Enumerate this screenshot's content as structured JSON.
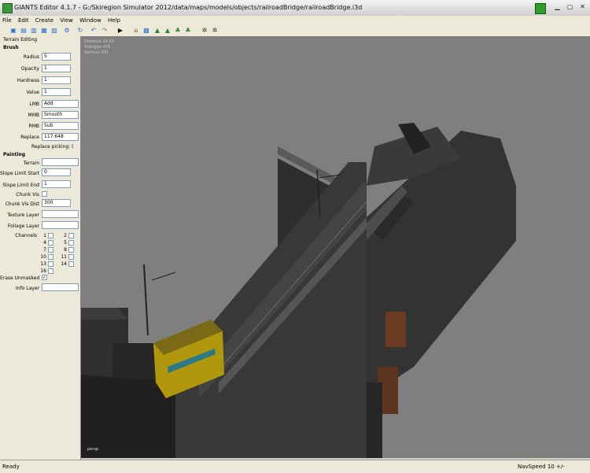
{
  "window": {
    "title": "GIANTS Editor 4.1.7 - G:/Skiregion Simulator 2012/data/maps/models/objects/railroadBridge/railroadBridge.i3d"
  },
  "menu": [
    "File",
    "Edit",
    "Create",
    "View",
    "Window",
    "Help"
  ],
  "panel": {
    "title": "Terrain Editing",
    "brush": {
      "heading": "Brush",
      "radius_label": "Radius",
      "radius_value": "5",
      "opacity_label": "Opacity",
      "opacity_value": "1",
      "hardness_label": "Hardness",
      "hardness_value": "1",
      "value_label": "Value",
      "value_value": "1",
      "lmb_label": "LMB",
      "lmb_value": "Add",
      "mmb_label": "MMB",
      "mmb_value": "Smooth",
      "rmb_label": "RMB",
      "rmb_value": "Sub",
      "replace_label": "Replace",
      "replace_value": "117.648",
      "replace_picking_label": "Replace picking: (",
      "replace_picking_value": ""
    },
    "painting": {
      "heading": "Painting",
      "terrain_label": "Terrain",
      "terrain_value": "",
      "slope_start_label": "Slope Limit Start",
      "slope_start_value": "0",
      "slope_end_label": "Slope Limit End",
      "slope_end_value": "1",
      "chunk_vis_label": "Chunk Vis",
      "chunk_vis_dist_label": "Chunk Vis Dist",
      "chunk_vis_dist_value": "300",
      "texture_layer_label": "Texture Layer",
      "texture_layer_value": "",
      "foliage_layer_label": "Foliage Layer",
      "foliage_layer_value": "",
      "channels_label": "Channels",
      "channels": [
        "1",
        "2",
        "4",
        "5",
        "7",
        "8",
        "10",
        "11",
        "13",
        "14",
        "16"
      ],
      "erase_unmasked_label": "Erase Unmasked",
      "erase_unmasked_checked": true,
      "info_layer_label": "Info Layer",
      "info_layer_value": ""
    }
  },
  "viewport": {
    "stats": [
      "Distance 29.93",
      "Triangles 476",
      "Vertices 681"
    ],
    "camera_label": "persp"
  },
  "status": {
    "left": "Ready",
    "right": "NavSpeed 10 +/-"
  }
}
